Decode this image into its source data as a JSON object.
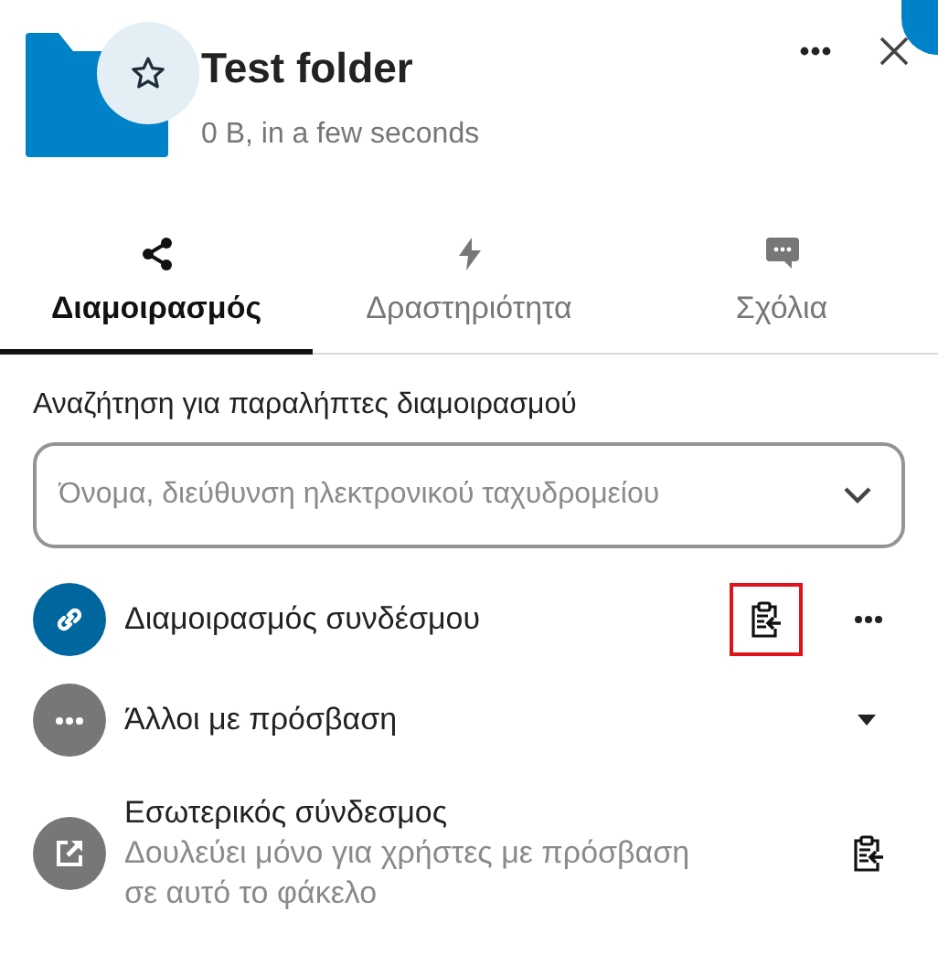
{
  "header": {
    "title": "Test folder",
    "subtitle": "0 B, in a few seconds",
    "favorite": false
  },
  "tabs": [
    {
      "kind": "share",
      "label": "Διαμοιρασμός",
      "selected": true
    },
    {
      "kind": "activity",
      "label": "Δραστηριότητα",
      "selected": false
    },
    {
      "kind": "comments",
      "label": "Σχόλια",
      "selected": false
    }
  ],
  "search": {
    "label": "Αναζήτηση για παραλήπτες διαμοιρασμού",
    "placeholder": "Όνομα, διεύθυνση ηλεκτρονικού ταχυδρομείου"
  },
  "entries": [
    {
      "kind": "link",
      "title": "Διαμοιρασμός συνδέσμου",
      "copy_highlighted": true
    },
    {
      "kind": "others",
      "title": "Άλλοι με πρόσβαση"
    },
    {
      "kind": "internal",
      "title": "Εσωτερικός σύνδεσμος",
      "subtitle": "Δουλεύει μόνο για χρήστες με πρόσβαση σε αυτό το φάκελο",
      "copy_highlighted": false
    }
  ]
}
